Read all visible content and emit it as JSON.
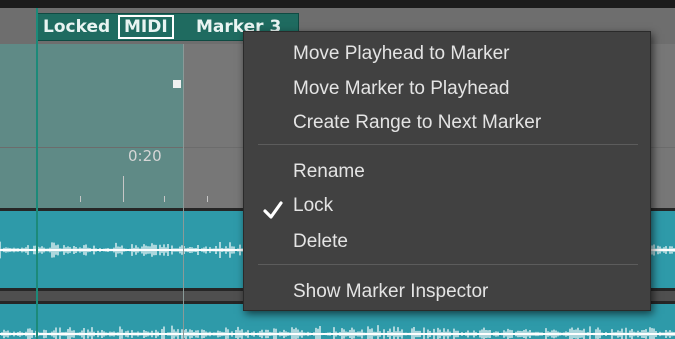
{
  "marker_lane": {
    "locked_label": "Locked",
    "midi_label": "MIDI",
    "marker_label": "Marker 3",
    "accent_color": "#1f6b60"
  },
  "ruler": {
    "time_label": "0:20"
  },
  "context_menu": {
    "group1": [
      "Move Playhead to Marker",
      "Move Marker to Playhead",
      "Create Range to Next Marker"
    ],
    "group2": {
      "rename": "Rename",
      "lock": "Lock",
      "lock_checked": true,
      "delete": "Delete"
    },
    "group3": [
      "Show Marker Inspector"
    ]
  },
  "icons": {
    "lock_check": "checkmark-icon"
  },
  "colors": {
    "track": "#2e9aa9",
    "menu_bg": "#414141",
    "menu_text": "#e4e4e4"
  }
}
